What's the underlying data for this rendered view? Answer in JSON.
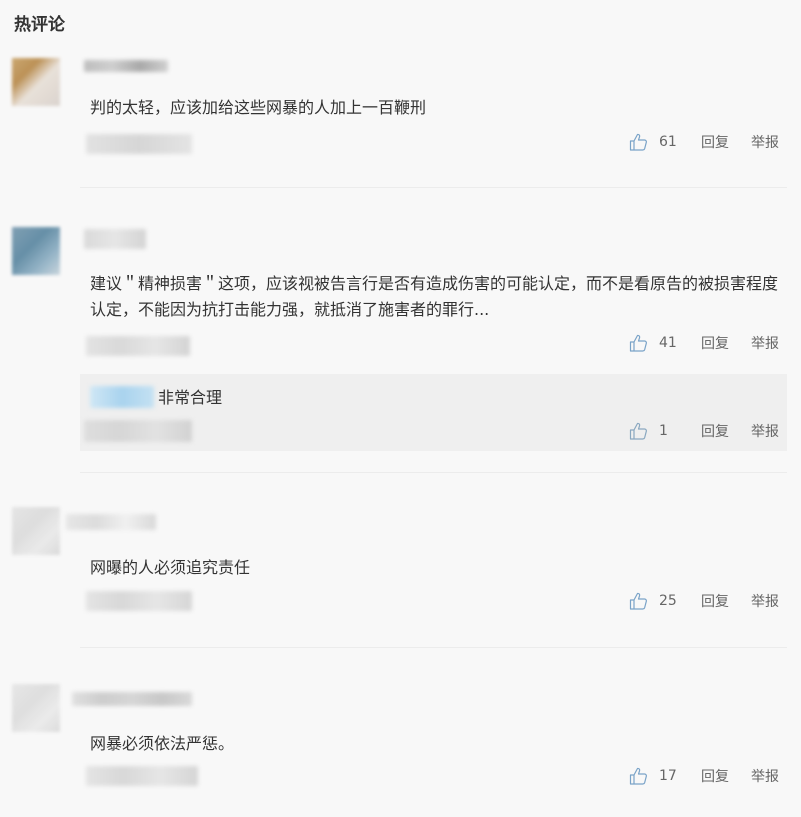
{
  "section": {
    "title": "热评论"
  },
  "comments": [
    {
      "content": "判的太轻，应该加给这些网暴的人加上一百鞭刑",
      "likes": "61",
      "reply_label": "回复",
      "report_label": "举报"
    },
    {
      "content": "建议＂精神损害＂这项，应该视被告言行是否有造成伤害的可能认定，而不是看原告的被损害程度认定，不能因为抗打击能力强，就抵消了施害者的罪行...",
      "likes": "41",
      "reply_label": "回复",
      "report_label": "举报",
      "reply": {
        "content": "非常合理",
        "likes": "1",
        "reply_label": "回复",
        "report_label": "举报"
      }
    },
    {
      "content": "网曝的人必须追究责任",
      "likes": "25",
      "reply_label": "回复",
      "report_label": "举报"
    },
    {
      "content": "网暴必须依法严惩。",
      "likes": "17",
      "reply_label": "回复",
      "report_label": "举报"
    }
  ],
  "colors": {
    "text": "#333333",
    "muted": "#666666",
    "divider": "#ececec",
    "reply_bg": "#efefef"
  },
  "icons": {
    "like": "thumbs-up-icon"
  }
}
